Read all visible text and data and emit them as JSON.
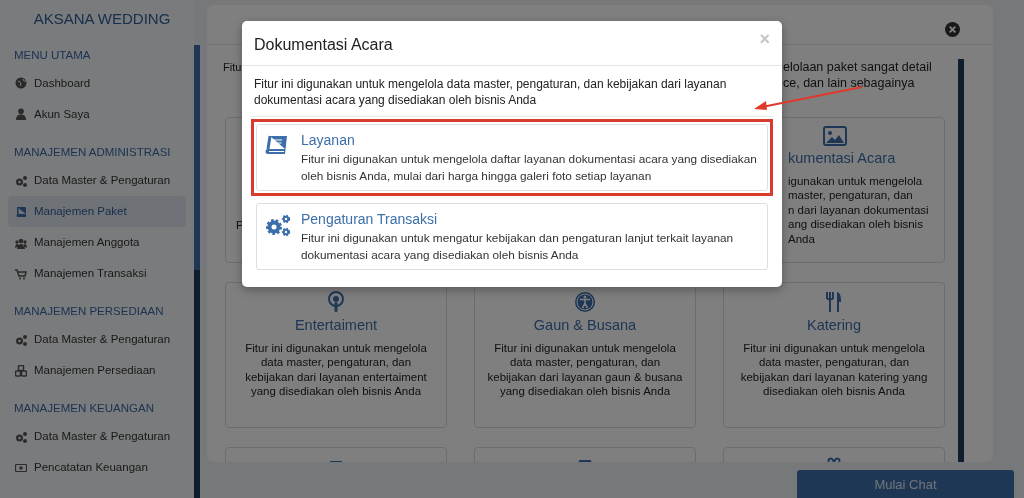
{
  "sidebar": {
    "brand": "AKSANA WEDDING",
    "sections": [
      {
        "heading": "MENU UTAMA",
        "items": [
          {
            "label": "Dashboard",
            "selected": false
          },
          {
            "label": "Akun Saya",
            "selected": false
          }
        ]
      },
      {
        "heading": "MANAJEMEN ADMINISTRASI",
        "items": [
          {
            "label": "Data Master & Pengaturan",
            "selected": false
          },
          {
            "label": "Manajemen Paket",
            "selected": true
          },
          {
            "label": "Manajemen Anggota",
            "selected": false
          },
          {
            "label": "Manajemen Transaksi",
            "selected": false
          }
        ]
      },
      {
        "heading": "MANAJEMEN PERSEDIAAN",
        "items": [
          {
            "label": "Data Master & Pengaturan",
            "selected": false
          },
          {
            "label": "Manajemen Persediaan",
            "selected": false
          }
        ]
      },
      {
        "heading": "MANAJEMEN KEUANGAN",
        "items": [
          {
            "label": "Data Master & Pengaturan",
            "selected": false
          },
          {
            "label": "Pencatatan Keuangan",
            "selected": false
          }
        ]
      }
    ]
  },
  "main": {
    "intro_left": "Fitu",
    "intro_right": [
      "elolaan paket sangat detail",
      "ce, dan lain sebagainya"
    ],
    "top_left_fragment": "P",
    "top_right_card": {
      "title": "kumentasi Acara",
      "lines": [
        "igunakan untuk mengelola",
        "master, pengaturan, dan",
        "n dari layanan dokumentasi",
        "ang disediakan oleh bisnis",
        "Anda"
      ]
    },
    "cards": [
      {
        "title": "Entertaiment",
        "description": "Fitur ini digunakan untuk mengelola data master, pengaturan, dan kebijakan dari layanan entertaiment yang disediakan oleh bisnis Anda"
      },
      {
        "title": "Gaun & Busana",
        "description": "Fitur ini digunakan untuk mengelola data master, pengaturan, dan kebijakan dari layanan gaun & busana yang disediakan oleh bisnis Anda"
      },
      {
        "title": "Katering",
        "description": "Fitur ini digunakan untuk mengelola data master, pengaturan, dan kebijakan dari layanan katering yang disediakan oleh bisnis Anda"
      }
    ]
  },
  "modal": {
    "title": "Dokumentasi Acara",
    "close": "×",
    "intro": "Fitur ini digunakan untuk mengelola data master, pengaturan, dan kebijakan dari layanan dokumentasi acara yang disediakan oleh bisnis Anda",
    "items": [
      {
        "title": "Layanan",
        "description": "Fitur ini digunakan untuk mengelola daftar layanan dokumentasi acara yang disediakan oleh bisnis Anda, mulai dari harga hingga galeri foto setiap layanan",
        "highlighted": true
      },
      {
        "title": "Pengaturan Transaksi",
        "description": "Fitur ini digunakan untuk mengatur kebijakan dan pengaturan lanjut terkait layanan dokumentasi acara yang disediakan oleh bisnis Anda",
        "highlighted": false
      }
    ]
  },
  "chat_button": "Mulai Chat"
}
